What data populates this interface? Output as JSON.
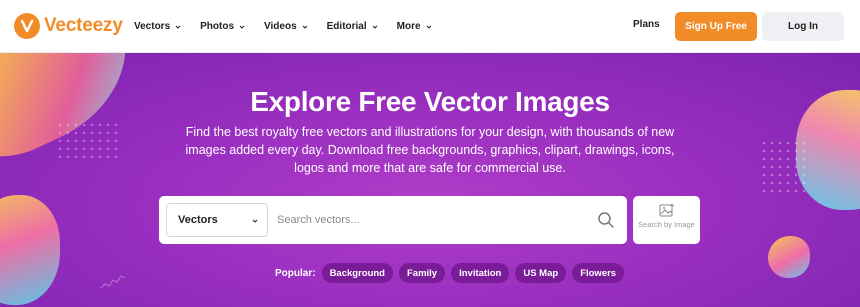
{
  "brand": {
    "name": "Vecteezy",
    "color": "#f28c28"
  },
  "nav": {
    "items": [
      {
        "label": "Vectors"
      },
      {
        "label": "Photos"
      },
      {
        "label": "Videos"
      },
      {
        "label": "Editorial"
      },
      {
        "label": "More"
      }
    ],
    "plans_label": "Plans",
    "signup_label": "Sign Up Free",
    "login_label": "Log In"
  },
  "hero": {
    "title": "Explore Free Vector Images",
    "subtitle": "Find the best royalty free vectors and illustrations for your design, with thousands of new images added every day. Download free backgrounds, graphics, clipart, drawings, icons, logos and more that are safe for commercial use."
  },
  "search": {
    "category_selected": "Vectors",
    "placeholder": "Search vectors...",
    "value": "",
    "image_search_label": "Search by Image"
  },
  "popular": {
    "label": "Popular:",
    "tags": [
      "Background",
      "Family",
      "Invitation",
      "US Map",
      "Flowers"
    ]
  },
  "icons": {
    "logo": "vecteezy-logo-icon",
    "chevron": "chevron-down-icon",
    "search": "search-icon",
    "image_search": "image-search-icon"
  },
  "colors": {
    "accent": "#f28c28",
    "hero_purple": "#9a2fc0",
    "tag_bg": "#7a1c98"
  }
}
